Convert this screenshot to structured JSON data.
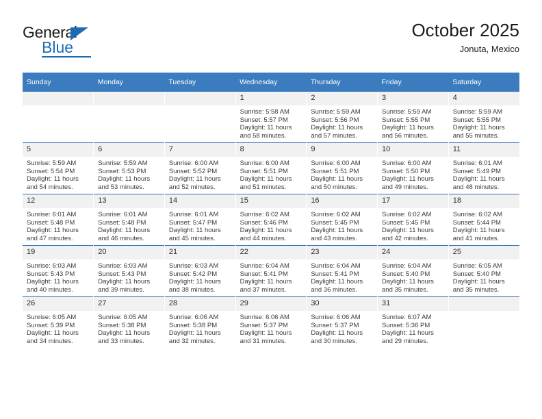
{
  "brand": {
    "name_top": "General",
    "name_bottom": "Blue",
    "accent_color": "#1b6cb5"
  },
  "header": {
    "title": "October 2025",
    "subtitle": "Jonuta, Mexico"
  },
  "calendar": {
    "header_color": "#3b7cbf",
    "weekdays": [
      "Sunday",
      "Monday",
      "Tuesday",
      "Wednesday",
      "Thursday",
      "Friday",
      "Saturday"
    ],
    "labels": {
      "sunrise": "Sunrise:",
      "sunset": "Sunset:",
      "daylight": "Daylight:"
    },
    "weeks": [
      [
        {
          "day": "",
          "empty": true
        },
        {
          "day": "",
          "empty": true
        },
        {
          "day": "",
          "empty": true
        },
        {
          "day": "1",
          "sunrise": "Sunrise: 5:58 AM",
          "sunset": "Sunset: 5:57 PM",
          "daylight": "Daylight: 11 hours and 58 minutes."
        },
        {
          "day": "2",
          "sunrise": "Sunrise: 5:59 AM",
          "sunset": "Sunset: 5:56 PM",
          "daylight": "Daylight: 11 hours and 57 minutes."
        },
        {
          "day": "3",
          "sunrise": "Sunrise: 5:59 AM",
          "sunset": "Sunset: 5:55 PM",
          "daylight": "Daylight: 11 hours and 56 minutes."
        },
        {
          "day": "4",
          "sunrise": "Sunrise: 5:59 AM",
          "sunset": "Sunset: 5:55 PM",
          "daylight": "Daylight: 11 hours and 55 minutes."
        }
      ],
      [
        {
          "day": "5",
          "sunrise": "Sunrise: 5:59 AM",
          "sunset": "Sunset: 5:54 PM",
          "daylight": "Daylight: 11 hours and 54 minutes."
        },
        {
          "day": "6",
          "sunrise": "Sunrise: 5:59 AM",
          "sunset": "Sunset: 5:53 PM",
          "daylight": "Daylight: 11 hours and 53 minutes."
        },
        {
          "day": "7",
          "sunrise": "Sunrise: 6:00 AM",
          "sunset": "Sunset: 5:52 PM",
          "daylight": "Daylight: 11 hours and 52 minutes."
        },
        {
          "day": "8",
          "sunrise": "Sunrise: 6:00 AM",
          "sunset": "Sunset: 5:51 PM",
          "daylight": "Daylight: 11 hours and 51 minutes."
        },
        {
          "day": "9",
          "sunrise": "Sunrise: 6:00 AM",
          "sunset": "Sunset: 5:51 PM",
          "daylight": "Daylight: 11 hours and 50 minutes."
        },
        {
          "day": "10",
          "sunrise": "Sunrise: 6:00 AM",
          "sunset": "Sunset: 5:50 PM",
          "daylight": "Daylight: 11 hours and 49 minutes."
        },
        {
          "day": "11",
          "sunrise": "Sunrise: 6:01 AM",
          "sunset": "Sunset: 5:49 PM",
          "daylight": "Daylight: 11 hours and 48 minutes."
        }
      ],
      [
        {
          "day": "12",
          "sunrise": "Sunrise: 6:01 AM",
          "sunset": "Sunset: 5:48 PM",
          "daylight": "Daylight: 11 hours and 47 minutes."
        },
        {
          "day": "13",
          "sunrise": "Sunrise: 6:01 AM",
          "sunset": "Sunset: 5:48 PM",
          "daylight": "Daylight: 11 hours and 46 minutes."
        },
        {
          "day": "14",
          "sunrise": "Sunrise: 6:01 AM",
          "sunset": "Sunset: 5:47 PM",
          "daylight": "Daylight: 11 hours and 45 minutes."
        },
        {
          "day": "15",
          "sunrise": "Sunrise: 6:02 AM",
          "sunset": "Sunset: 5:46 PM",
          "daylight": "Daylight: 11 hours and 44 minutes."
        },
        {
          "day": "16",
          "sunrise": "Sunrise: 6:02 AM",
          "sunset": "Sunset: 5:45 PM",
          "daylight": "Daylight: 11 hours and 43 minutes."
        },
        {
          "day": "17",
          "sunrise": "Sunrise: 6:02 AM",
          "sunset": "Sunset: 5:45 PM",
          "daylight": "Daylight: 11 hours and 42 minutes."
        },
        {
          "day": "18",
          "sunrise": "Sunrise: 6:02 AM",
          "sunset": "Sunset: 5:44 PM",
          "daylight": "Daylight: 11 hours and 41 minutes."
        }
      ],
      [
        {
          "day": "19",
          "sunrise": "Sunrise: 6:03 AM",
          "sunset": "Sunset: 5:43 PM",
          "daylight": "Daylight: 11 hours and 40 minutes."
        },
        {
          "day": "20",
          "sunrise": "Sunrise: 6:03 AM",
          "sunset": "Sunset: 5:43 PM",
          "daylight": "Daylight: 11 hours and 39 minutes."
        },
        {
          "day": "21",
          "sunrise": "Sunrise: 6:03 AM",
          "sunset": "Sunset: 5:42 PM",
          "daylight": "Daylight: 11 hours and 38 minutes."
        },
        {
          "day": "22",
          "sunrise": "Sunrise: 6:04 AM",
          "sunset": "Sunset: 5:41 PM",
          "daylight": "Daylight: 11 hours and 37 minutes."
        },
        {
          "day": "23",
          "sunrise": "Sunrise: 6:04 AM",
          "sunset": "Sunset: 5:41 PM",
          "daylight": "Daylight: 11 hours and 36 minutes."
        },
        {
          "day": "24",
          "sunrise": "Sunrise: 6:04 AM",
          "sunset": "Sunset: 5:40 PM",
          "daylight": "Daylight: 11 hours and 35 minutes."
        },
        {
          "day": "25",
          "sunrise": "Sunrise: 6:05 AM",
          "sunset": "Sunset: 5:40 PM",
          "daylight": "Daylight: 11 hours and 35 minutes."
        }
      ],
      [
        {
          "day": "26",
          "sunrise": "Sunrise: 6:05 AM",
          "sunset": "Sunset: 5:39 PM",
          "daylight": "Daylight: 11 hours and 34 minutes."
        },
        {
          "day": "27",
          "sunrise": "Sunrise: 6:05 AM",
          "sunset": "Sunset: 5:38 PM",
          "daylight": "Daylight: 11 hours and 33 minutes."
        },
        {
          "day": "28",
          "sunrise": "Sunrise: 6:06 AM",
          "sunset": "Sunset: 5:38 PM",
          "daylight": "Daylight: 11 hours and 32 minutes."
        },
        {
          "day": "29",
          "sunrise": "Sunrise: 6:06 AM",
          "sunset": "Sunset: 5:37 PM",
          "daylight": "Daylight: 11 hours and 31 minutes."
        },
        {
          "day": "30",
          "sunrise": "Sunrise: 6:06 AM",
          "sunset": "Sunset: 5:37 PM",
          "daylight": "Daylight: 11 hours and 30 minutes."
        },
        {
          "day": "31",
          "sunrise": "Sunrise: 6:07 AM",
          "sunset": "Sunset: 5:36 PM",
          "daylight": "Daylight: 11 hours and 29 minutes."
        },
        {
          "day": "",
          "empty": true
        }
      ]
    ]
  }
}
